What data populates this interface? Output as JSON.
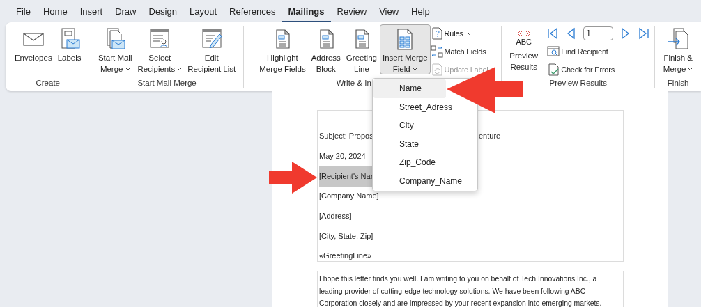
{
  "menu_tabs": [
    {
      "label": "File",
      "selected": false
    },
    {
      "label": "Home",
      "selected": false
    },
    {
      "label": "Insert",
      "selected": false
    },
    {
      "label": "Draw",
      "selected": false
    },
    {
      "label": "Design",
      "selected": false
    },
    {
      "label": "Layout",
      "selected": false
    },
    {
      "label": "References",
      "selected": false
    },
    {
      "label": "Mailings",
      "selected": true
    },
    {
      "label": "Review",
      "selected": false
    },
    {
      "label": "View",
      "selected": false
    },
    {
      "label": "Help",
      "selected": false
    }
  ],
  "ribbon": {
    "groups": [
      {
        "label": "Create",
        "buttons": [
          {
            "kind": "large",
            "lines": [
              "Envelopes"
            ],
            "dropdown": false,
            "pressed": false
          },
          {
            "kind": "large",
            "lines": [
              "Labels"
            ],
            "dropdown": false,
            "pressed": false
          }
        ]
      },
      {
        "label": "Start Mail Merge",
        "buttons": [
          {
            "kind": "large",
            "lines": [
              "Start Mail",
              "Merge"
            ],
            "dropdown": true,
            "pressed": false
          },
          {
            "kind": "large",
            "lines": [
              "Select",
              "Recipients"
            ],
            "dropdown": true,
            "pressed": false
          },
          {
            "kind": "large",
            "lines": [
              "Edit",
              "Recipient List"
            ],
            "dropdown": false,
            "pressed": false
          }
        ]
      },
      {
        "label": "Write & In",
        "buttons": [
          {
            "kind": "large",
            "lines": [
              "Highlight",
              "Merge Fields"
            ],
            "dropdown": false,
            "pressed": false
          },
          {
            "kind": "large",
            "lines": [
              "Address",
              "Block"
            ],
            "dropdown": false,
            "pressed": false
          },
          {
            "kind": "large",
            "lines": [
              "Greeting",
              "Line"
            ],
            "dropdown": false,
            "pressed": false
          },
          {
            "kind": "large",
            "lines": [
              "Insert Merge",
              "Field"
            ],
            "dropdown": true,
            "pressed": true
          },
          {
            "kind": "small_stack",
            "items": [
              {
                "label": "Rules",
                "dropdown": true,
                "disabled": false
              },
              {
                "label": "Match Fields",
                "dropdown": false,
                "disabled": false
              },
              {
                "label": "Update Label",
                "dropdown": false,
                "disabled": true
              }
            ]
          }
        ]
      },
      {
        "label": "Preview Results",
        "buttons": [
          {
            "kind": "preview",
            "icon_text": "ABC",
            "lines": [
              "Preview",
              "Results"
            ],
            "dropdown": false,
            "pressed": false
          },
          {
            "kind": "navigation",
            "record": "1",
            "items": [
              {
                "label": "Find Recipient",
                "dropdown": false,
                "disabled": false
              },
              {
                "label": "Check for Errors",
                "dropdown": false,
                "disabled": false
              }
            ]
          }
        ]
      },
      {
        "label": "Finish",
        "buttons": [
          {
            "kind": "large",
            "lines": [
              "Finish &",
              "Merge"
            ],
            "dropdown": true,
            "pressed": false
          }
        ]
      }
    ]
  },
  "merge_field_menu": {
    "items": [
      {
        "label": "Name_",
        "selected": true
      },
      {
        "label": "Street_Adress",
        "selected": false
      },
      {
        "label": "City",
        "selected": false
      },
      {
        "label": "State",
        "selected": false
      },
      {
        "label": "Zip_Code",
        "selected": false
      },
      {
        "label": "Company_Name",
        "selected": false
      }
    ]
  },
  "document": {
    "header_lines": [
      {
        "kind": "split",
        "left": "Subject: Propos",
        "right": "enture"
      },
      {
        "kind": "plain",
        "text": "May 20, 2024"
      },
      {
        "kind": "highlighted",
        "text": "[Recipient's Nar"
      },
      {
        "kind": "plain",
        "text": "[Company Name]"
      },
      {
        "kind": "plain",
        "text": "[Address]"
      },
      {
        "kind": "plain",
        "text": "[City, State, Zip]"
      },
      {
        "kind": "plain",
        "text": "«GreetingLine»"
      }
    ],
    "body_lines": [
      "I hope this letter finds you well. I am writing to you on behalf of Tech Innovations Inc., a",
      "leading provider of cutting-edge technology solutions. We have been following ABC",
      "Corporation closely and are impressed by your recent expansion into emerging markets."
    ]
  }
}
